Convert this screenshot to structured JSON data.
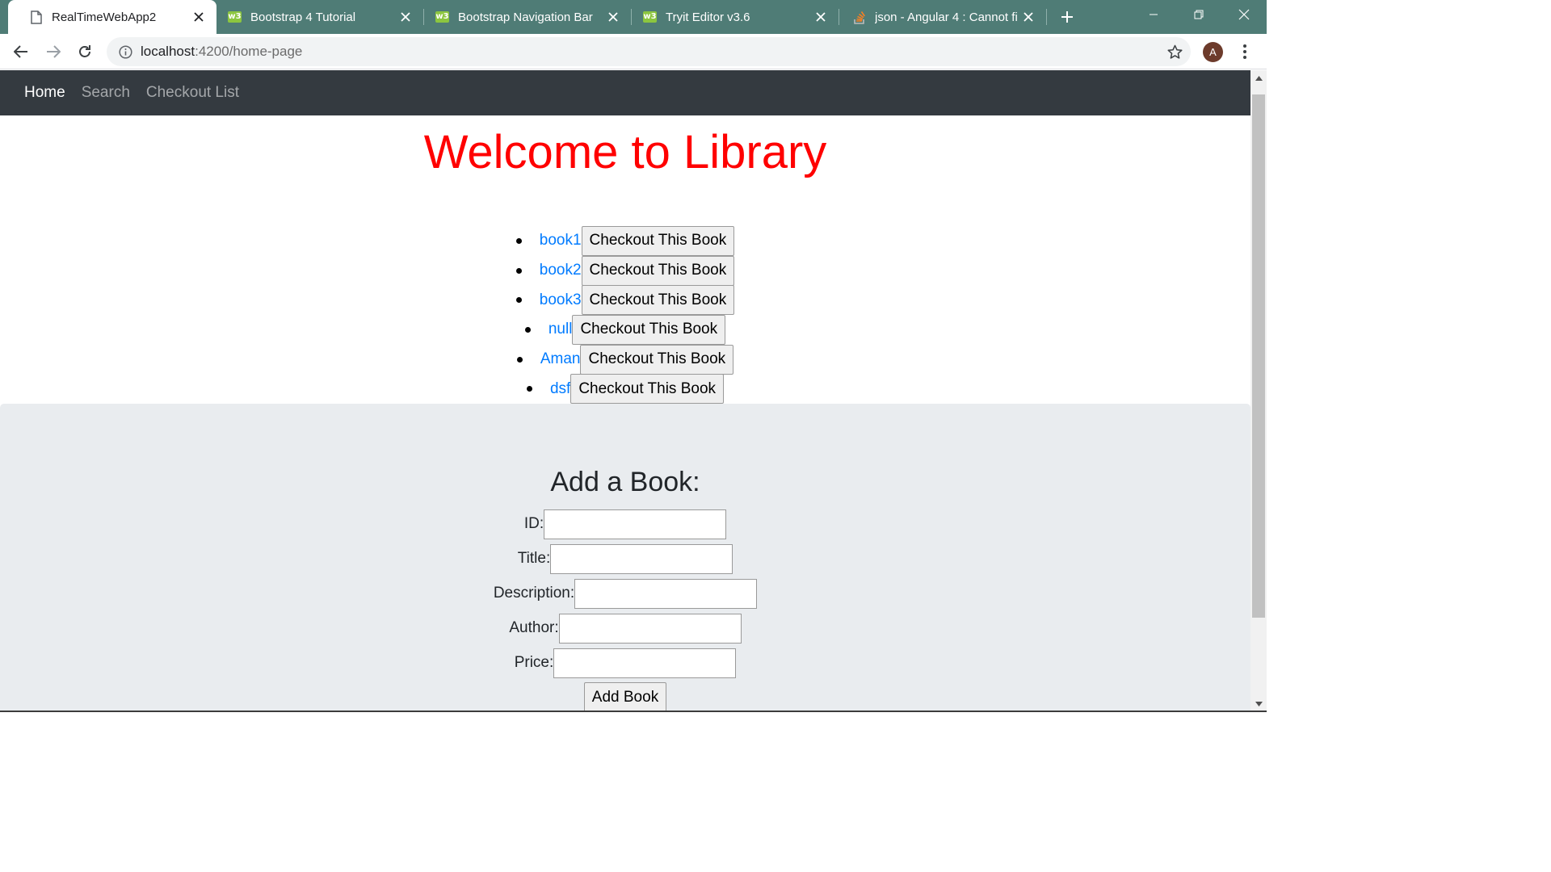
{
  "browser": {
    "tabs": [
      {
        "title": "RealTimeWebApp2",
        "icon": "page-icon",
        "active": true
      },
      {
        "title": "Bootstrap 4 Tutorial",
        "icon": "w3schools-icon",
        "active": false
      },
      {
        "title": "Bootstrap Navigation Bar",
        "icon": "w3schools-icon",
        "active": false
      },
      {
        "title": "Tryit Editor v3.6",
        "icon": "w3schools-icon",
        "active": false
      },
      {
        "title": "json - Angular 4 : Cannot fi",
        "icon": "stackoverflow-icon",
        "active": false
      }
    ],
    "address": {
      "host": "localhost",
      "path": ":4200/home-page"
    },
    "profile_initial": "A",
    "colors": {
      "tabstrip": "#4f7c76",
      "navbar": "#343a40",
      "accent": "#007bff",
      "heading": "#ff0000"
    }
  },
  "nav": {
    "home": "Home",
    "search": "Search",
    "checkout_list": "Checkout List"
  },
  "page": {
    "heading": "Welcome to Library"
  },
  "books": [
    {
      "title": "book1",
      "button": "Checkout This Book"
    },
    {
      "title": "book2",
      "button": "Checkout This Book"
    },
    {
      "title": "book3",
      "button": "Checkout This Book"
    },
    {
      "title": "null",
      "button": "Checkout This Book"
    },
    {
      "title": "Aman",
      "button": "Checkout This Book"
    },
    {
      "title": "dsf",
      "button": "Checkout This Book"
    }
  ],
  "add_form": {
    "title": "Add a Book:",
    "fields": [
      {
        "label": "ID:",
        "value": ""
      },
      {
        "label": "Title:",
        "value": ""
      },
      {
        "label": "Description:",
        "value": ""
      },
      {
        "label": "Author:",
        "value": ""
      },
      {
        "label": "Price:",
        "value": ""
      }
    ],
    "submit": "Add Book"
  }
}
